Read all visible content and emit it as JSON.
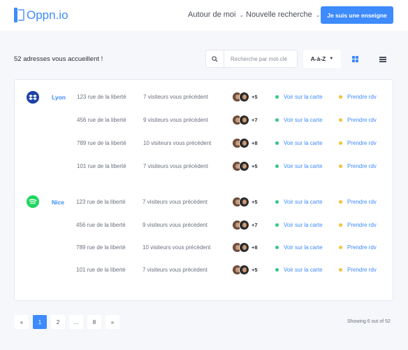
{
  "header": {
    "logo_text": "Oppn.io",
    "nav": [
      {
        "label": "Autour de moi",
        "icon": "chevron-down-icon"
      },
      {
        "label": "Nouvelle recherche",
        "icon": "chevron-down-icon"
      }
    ],
    "cta_label": "Je suis une enseigne"
  },
  "toolbar": {
    "results_text": "52 adresses vous accueillent !",
    "search_placeholder": "Recherche par mot-clé",
    "sort_label": "A-à-Z",
    "view_icons": [
      "grid-icon",
      "list-icon"
    ]
  },
  "cities": [
    {
      "name": "Lyon",
      "icon": "dropbox-icon",
      "color": "#1c3fa8",
      "rows": [
        {
          "address": "123 rue de la liberté",
          "visitors": "7 visiteurs vous précèdent",
          "extra": "+5",
          "map_label": "Voir sur la carte",
          "rdv_label": "Prendre rdv"
        },
        {
          "address": "456 rue de la liberté",
          "visitors": "9 visiteurs vous précèdent",
          "extra": "+7",
          "map_label": "Voir sur la carte",
          "rdv_label": "Prendre rdv"
        },
        {
          "address": "789 rue de la liberté",
          "visitors": "10 visiteurs vous précèdent",
          "extra": "+8",
          "map_label": "Voir sur la carte",
          "rdv_label": "Prendre rdv"
        },
        {
          "address": "101 rue de la liberté",
          "visitors": "7 visiteurs vous précèdent",
          "extra": "+5",
          "map_label": "Voir sur la carte",
          "rdv_label": "Prendre rdv"
        }
      ]
    },
    {
      "name": "Nice",
      "icon": "spotify-icon",
      "color": "#1ed760",
      "rows": [
        {
          "address": "123 rue de la liberté",
          "visitors": "7 visiteurs vous précèdent",
          "extra": "+5",
          "map_label": "Voir sur la carte",
          "rdv_label": "Prendre rdv"
        },
        {
          "address": "456 rue de la liberté",
          "visitors": "9 visiteurs vous précèdent",
          "extra": "+7",
          "map_label": "Voir sur la carte",
          "rdv_label": "Prendre rdv"
        },
        {
          "address": "789 rue de la liberté",
          "visitors": "10 visiteurs vous précèdent",
          "extra": "+8",
          "map_label": "Voir sur la carte",
          "rdv_label": "Prendre rdv"
        },
        {
          "address": "101 rue de la liberté",
          "visitors": "7 visiteurs vous précèdent",
          "extra": "+5",
          "map_label": "Voir sur la carte",
          "rdv_label": "Prendre rdv"
        }
      ]
    }
  ],
  "colors": {
    "accent": "#3d8bfd",
    "map_dot": "#35c48f",
    "rdv_dot": "#f5c13c"
  },
  "pagination": {
    "prev": "«",
    "pages": [
      "1",
      "2",
      "...",
      "8"
    ],
    "active": "1",
    "next": "»",
    "showing": "Showing 6 out of 52"
  }
}
